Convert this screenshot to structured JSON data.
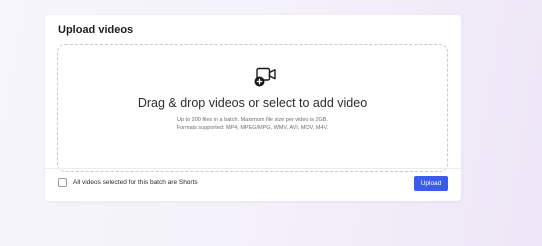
{
  "upload_card": {
    "title": "Upload videos",
    "dropzone": {
      "icon": "video-add-icon",
      "heading": "Drag & drop videos or select to add video",
      "limits_note": "Up to 200 files in a batch. Maximum file size per video is 2GB.",
      "formats_note": "Formats supported: MP4, MPEG/MPG, WMV, AVI, MOV, M4V."
    },
    "shorts_checkbox": {
      "label": "All videos selected for this batch are Shorts",
      "checked": false
    },
    "upload_button": {
      "label": "Upload",
      "color": "#3b5bea"
    }
  }
}
